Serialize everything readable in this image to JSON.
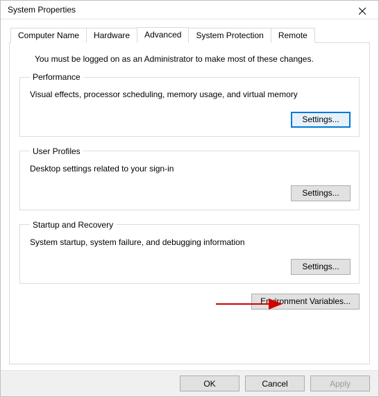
{
  "window": {
    "title": "System Properties"
  },
  "tabs": {
    "computer_name": "Computer Name",
    "hardware": "Hardware",
    "advanced": "Advanced",
    "system_protection": "System Protection",
    "remote": "Remote"
  },
  "intro": "You must be logged on as an Administrator to make most of these changes.",
  "groups": {
    "performance": {
      "legend": "Performance",
      "desc": "Visual effects, processor scheduling, memory usage, and virtual memory",
      "button": "Settings..."
    },
    "profiles": {
      "legend": "User Profiles",
      "desc": "Desktop settings related to your sign-in",
      "button": "Settings..."
    },
    "startup": {
      "legend": "Startup and Recovery",
      "desc": "System startup, system failure, and debugging information",
      "button": "Settings..."
    }
  },
  "env_button": "Environment Variables...",
  "footer": {
    "ok": "OK",
    "cancel": "Cancel",
    "apply": "Apply"
  }
}
